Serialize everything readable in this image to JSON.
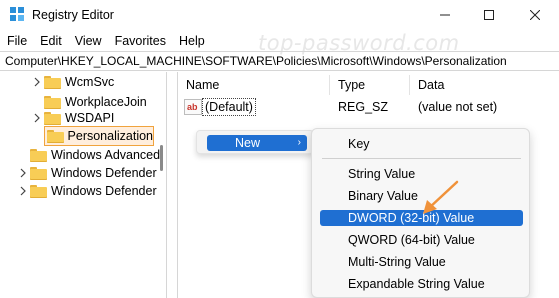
{
  "window": {
    "title": "Registry Editor",
    "minimize_icon": "minimize-icon",
    "maximize_icon": "maximize-icon",
    "close_icon": "close-icon"
  },
  "watermark": "top-password.com",
  "menu": [
    "File",
    "Edit",
    "View",
    "Favorites",
    "Help"
  ],
  "address": "Computer\\HKEY_LOCAL_MACHINE\\SOFTWARE\\Policies\\Microsoft\\Windows\\Personalization",
  "tree": {
    "items": [
      {
        "label": "WcmSvc",
        "expandable": true
      },
      {
        "label": "WorkplaceJoin",
        "expandable": false
      },
      {
        "label": "WSDAPI",
        "expandable": true
      },
      {
        "label": "Personalization",
        "expandable": false,
        "selected": true
      },
      {
        "label": "Windows Advanced",
        "expandable": false
      },
      {
        "label": "Windows Defender",
        "expandable": true
      },
      {
        "label": "Windows Defender",
        "expandable": true
      }
    ]
  },
  "list": {
    "columns": [
      "Name",
      "Type",
      "Data"
    ],
    "rows": [
      {
        "icon": "ab",
        "name": "(Default)",
        "type": "REG_SZ",
        "data": "(value not set)"
      }
    ]
  },
  "context_menu": {
    "new_label": "New",
    "submenu_arrow": "›"
  },
  "submenu": {
    "items": [
      "Key",
      "String Value",
      "Binary Value",
      "DWORD (32-bit) Value",
      "QWORD (64-bit) Value",
      "Multi-String Value",
      "Expandable String Value"
    ],
    "highlighted": "DWORD (32-bit) Value"
  },
  "colors": {
    "highlight": "#1f6fd2",
    "selected_border": "#f0a33d",
    "annotation_arrow": "#f0923a",
    "folder": "#f8cd56"
  }
}
